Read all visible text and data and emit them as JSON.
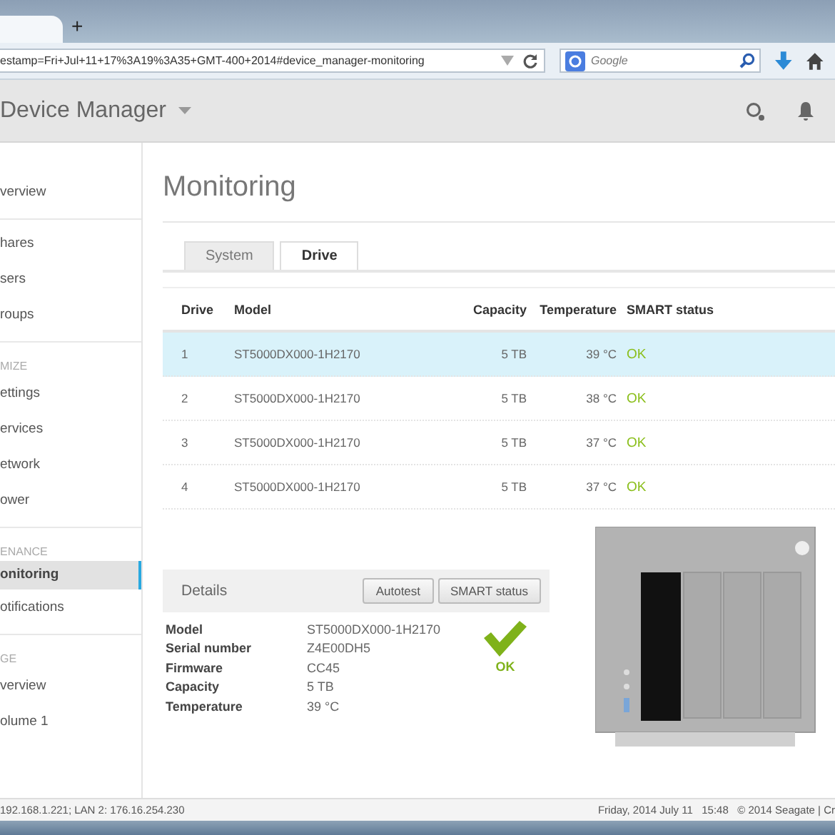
{
  "browser": {
    "new_tab": "+",
    "url": "estamp=Fri+Jul+11+17%3A19%3A35+GMT-400+2014#device_manager-monitoring",
    "search_placeholder": "Google"
  },
  "header": {
    "title": "Device Manager"
  },
  "sidebar": {
    "sections": [
      {
        "items": [
          {
            "label": "verview",
            "selected": false
          }
        ]
      },
      {
        "items": [
          {
            "label": "hares",
            "selected": false
          },
          {
            "label": "sers",
            "selected": false
          },
          {
            "label": "roups",
            "selected": false
          }
        ]
      },
      {
        "heading": "MIZE",
        "items": [
          {
            "label": "ettings",
            "selected": false
          },
          {
            "label": "ervices",
            "selected": false
          },
          {
            "label": "etwork",
            "selected": false
          },
          {
            "label": "ower",
            "selected": false
          }
        ]
      },
      {
        "heading": "ENANCE",
        "items": [
          {
            "label": "onitoring",
            "selected": true
          },
          {
            "label": "otifications",
            "selected": false
          }
        ]
      },
      {
        "heading": "GE",
        "items": [
          {
            "label": "verview",
            "selected": false
          },
          {
            "label": "olume 1",
            "selected": false
          }
        ]
      }
    ]
  },
  "page_title": "Monitoring",
  "tabs": [
    {
      "label": "System",
      "selected": false
    },
    {
      "label": "Drive",
      "selected": true
    }
  ],
  "table": {
    "columns": [
      "Drive",
      "Model",
      "Capacity",
      "Temperature",
      "SMART status"
    ],
    "rows": [
      {
        "drive": "1",
        "model": "ST5000DX000-1H2170",
        "capacity": "5 TB",
        "temperature": "39 °C",
        "status": "OK",
        "selected": true
      },
      {
        "drive": "2",
        "model": "ST5000DX000-1H2170",
        "capacity": "5 TB",
        "temperature": "38 °C",
        "status": "OK",
        "selected": false
      },
      {
        "drive": "3",
        "model": "ST5000DX000-1H2170",
        "capacity": "5 TB",
        "temperature": "37 °C",
        "status": "OK",
        "selected": false
      },
      {
        "drive": "4",
        "model": "ST5000DX000-1H2170",
        "capacity": "5 TB",
        "temperature": "37 °C",
        "status": "OK",
        "selected": false
      }
    ]
  },
  "details": {
    "title": "Details",
    "buttons": [
      "Autotest",
      "SMART status"
    ],
    "fields": [
      {
        "label": "Model",
        "value": "ST5000DX000-1H2170"
      },
      {
        "label": "Serial number",
        "value": "Z4E00DH5"
      },
      {
        "label": "Firmware",
        "value": "CC45"
      },
      {
        "label": "Capacity",
        "value": "5 TB"
      },
      {
        "label": "Temperature",
        "value": "39 °C"
      }
    ],
    "status": "OK"
  },
  "status_bar": {
    "left": "192.168.1.221; LAN 2: 176.16.254.230",
    "right": "Friday, 2014 July 11   15:48   © 2014 Seagate | Cr"
  }
}
